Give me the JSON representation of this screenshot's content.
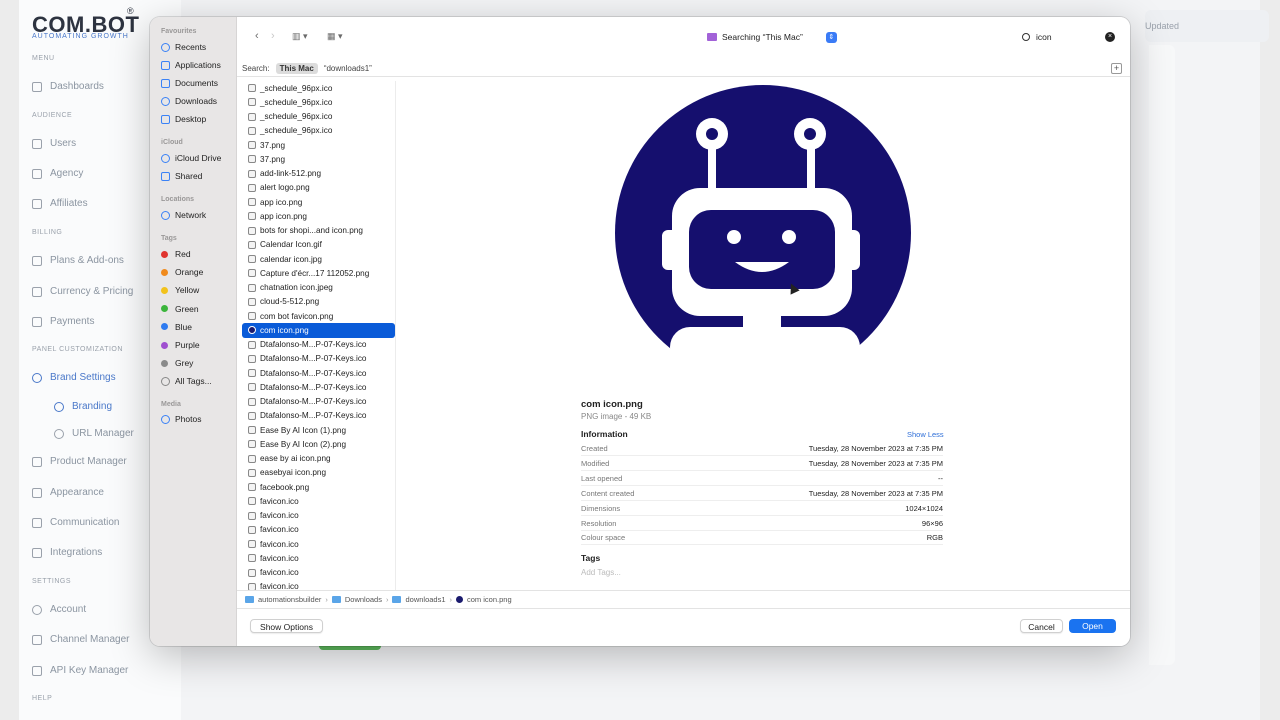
{
  "app": {
    "logo": "COM.BOT",
    "logo_reg": "®",
    "tagline": "AUTOMATING GROWTH",
    "last_updated": "Updated",
    "sections": {
      "menu": "MENU",
      "audience": "AUDIENCE",
      "billing": "BILLING",
      "panel": "PANEL CUSTOMIZATION",
      "settings": "SETTINGS",
      "help": "HELP"
    },
    "nav": {
      "dashboards": "Dashboards",
      "users": "Users",
      "agency": "Agency",
      "affiliates": "Affiliates",
      "plans": "Plans & Add-ons",
      "currency": "Currency & Pricing",
      "payments": "Payments",
      "brand_settings": "Brand Settings",
      "branding": "Branding",
      "url_manager": "URL Manager",
      "product_manager": "Product Manager",
      "appearance": "Appearance",
      "communication": "Communication",
      "integrations": "Integrations",
      "account": "Account",
      "channel_manager": "Channel Manager",
      "api_key_manager": "API Key Manager"
    }
  },
  "dialog": {
    "sidebar": {
      "favourites_header": "Favourites",
      "favourites": [
        "Recents",
        "Applications",
        "Documents",
        "Downloads",
        "Desktop"
      ],
      "icloud_header": "iCloud",
      "icloud": [
        "iCloud Drive",
        "Shared"
      ],
      "locations_header": "Locations",
      "locations": [
        "Network"
      ],
      "tags_header": "Tags",
      "tags": [
        {
          "label": "Red",
          "color": "#e0342f"
        },
        {
          "label": "Orange",
          "color": "#f08a1c"
        },
        {
          "label": "Yellow",
          "color": "#f2c21b"
        },
        {
          "label": "Green",
          "color": "#3cb53c"
        },
        {
          "label": "Blue",
          "color": "#2f7bf0"
        },
        {
          "label": "Purple",
          "color": "#a050d0"
        },
        {
          "label": "Grey",
          "color": "#8a8a8a"
        }
      ],
      "all_tags": "All Tags...",
      "media_header": "Media",
      "media": [
        "Photos"
      ]
    },
    "toolbar": {
      "back_icon": "chevron-left-icon",
      "forward_icon": "chevron-right-icon",
      "location_label": "Searching “This Mac”",
      "search_value": "icon"
    },
    "scope": {
      "label": "Search:",
      "this_mac": "This Mac",
      "folder": "“downloads1”"
    },
    "files": [
      "_schedule_96px.ico",
      "_schedule_96px.ico",
      "_schedule_96px.ico",
      "_schedule_96px.ico",
      "37.png",
      "37.png",
      "add-link-512.png",
      "alert logo.png",
      "app ico.png",
      "app icon.png",
      "bots for shopi...and icon.png",
      "Calendar Icon.gif",
      "calendar icon.jpg",
      "Capture d'écr...17 112052.png",
      "chatnation icon.jpeg",
      "cloud-5-512.png",
      "com bot favicon.png",
      "com icon.png",
      "Dtafalonso-M...P-07-Keys.ico",
      "Dtafalonso-M...P-07-Keys.ico",
      "Dtafalonso-M...P-07-Keys.ico",
      "Dtafalonso-M...P-07-Keys.ico",
      "Dtafalonso-M...P-07-Keys.ico",
      "Dtafalonso-M...P-07-Keys.ico",
      "Ease By AI Icon (1).png",
      "Ease By AI Icon (2).png",
      "ease by ai icon.png",
      "easebyai icon.png",
      "facebook.png",
      "favicon.ico",
      "favicon.ico",
      "favicon.ico",
      "favicon.ico",
      "favicon.ico",
      "favicon.ico",
      "favicon.ico"
    ],
    "selected_index": 17,
    "preview": {
      "name": "com icon.png",
      "kind": "PNG image - 49 KB",
      "info_header": "Information",
      "show_less": "Show Less",
      "rows": [
        {
          "k": "Created",
          "v": "Tuesday, 28 November 2023 at 7:35 PM"
        },
        {
          "k": "Modified",
          "v": "Tuesday, 28 November 2023 at 7:35 PM"
        },
        {
          "k": "Last opened",
          "v": "--"
        },
        {
          "k": "Content created",
          "v": "Tuesday, 28 November 2023 at 7:35 PM"
        },
        {
          "k": "Dimensions",
          "v": "1024×1024"
        },
        {
          "k": "Resolution",
          "v": "96×96"
        },
        {
          "k": "Colour space",
          "v": "RGB"
        }
      ],
      "tags_header": "Tags",
      "add_tags": "Add Tags...",
      "image_color": "#150f6e"
    },
    "path": [
      "automationsbuilder",
      "Downloads",
      "downloads1",
      "com icon.png"
    ],
    "buttons": {
      "show_options": "Show Options",
      "cancel": "Cancel",
      "open": "Open"
    }
  }
}
